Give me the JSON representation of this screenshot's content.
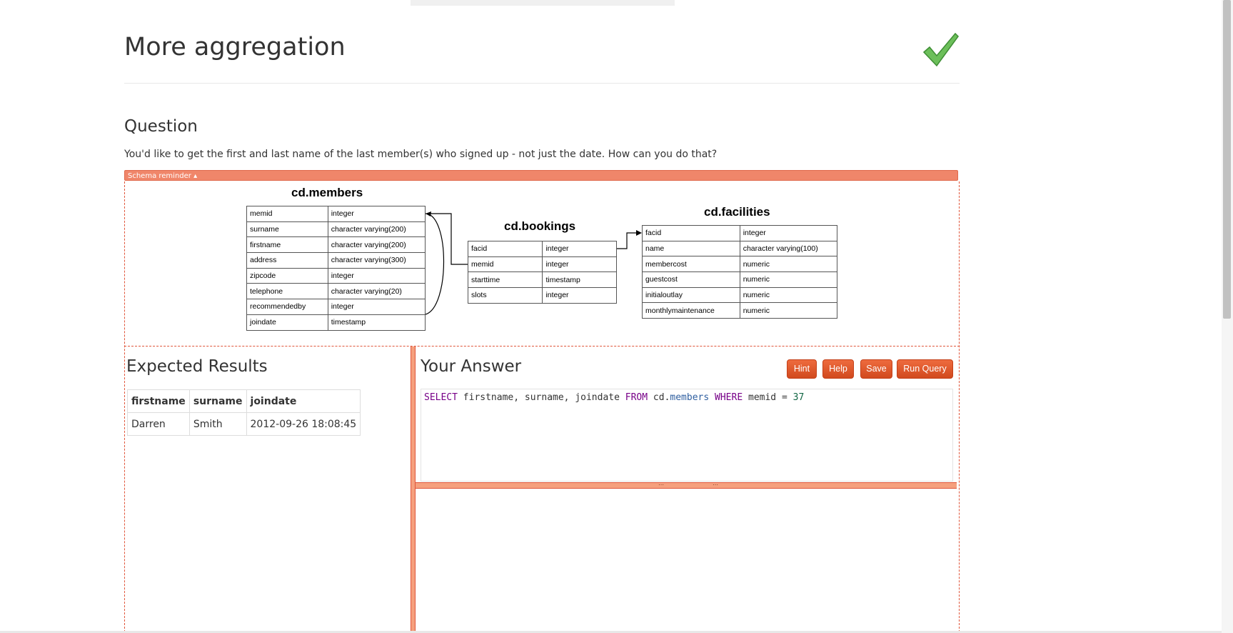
{
  "page": {
    "title": "More aggregation"
  },
  "question": {
    "heading": "Question",
    "text": "You'd like to get the first and last name of the last member(s) who signed up - not just the date. How can you do that?"
  },
  "schema": {
    "toggle_label": "Schema reminder ▴",
    "tables": [
      {
        "name": "cd.members",
        "columns": [
          [
            "memid",
            "integer"
          ],
          [
            "surname",
            "character varying(200)"
          ],
          [
            "firstname",
            "character varying(200)"
          ],
          [
            "address",
            "character varying(300)"
          ],
          [
            "zipcode",
            "integer"
          ],
          [
            "telephone",
            "character varying(20)"
          ],
          [
            "recommendedby",
            "integer"
          ],
          [
            "joindate",
            "timestamp"
          ]
        ]
      },
      {
        "name": "cd.bookings",
        "columns": [
          [
            "facid",
            "integer"
          ],
          [
            "memid",
            "integer"
          ],
          [
            "starttime",
            "timestamp"
          ],
          [
            "slots",
            "integer"
          ]
        ]
      },
      {
        "name": "cd.facilities",
        "columns": [
          [
            "facid",
            "integer"
          ],
          [
            "name",
            "character varying(100)"
          ],
          [
            "membercost",
            "numeric"
          ],
          [
            "guestcost",
            "numeric"
          ],
          [
            "initialoutlay",
            "numeric"
          ],
          [
            "monthlymaintenance",
            "numeric"
          ]
        ]
      }
    ]
  },
  "expected": {
    "heading": "Expected Results",
    "columns": [
      "firstname",
      "surname",
      "joindate"
    ],
    "rows": [
      [
        "Darren",
        "Smith",
        "2012-09-26 18:08:45"
      ]
    ]
  },
  "answer": {
    "heading": "Your Answer",
    "buttons": {
      "hint": "Hint",
      "help": "Help",
      "save": "Save",
      "run": "Run Query"
    },
    "query_tokens": {
      "select": "SELECT",
      "cols": " firstname, surname, joindate ",
      "from": "FROM",
      "schema": " cd.",
      "table": "members",
      "where": "WHERE",
      "cond": " memid = ",
      "value": "37"
    }
  },
  "colors": {
    "accent": "#e0553a",
    "button": "#d9532a",
    "check": "#5cb85c"
  },
  "icons": {
    "status": "checkmark-icon"
  }
}
